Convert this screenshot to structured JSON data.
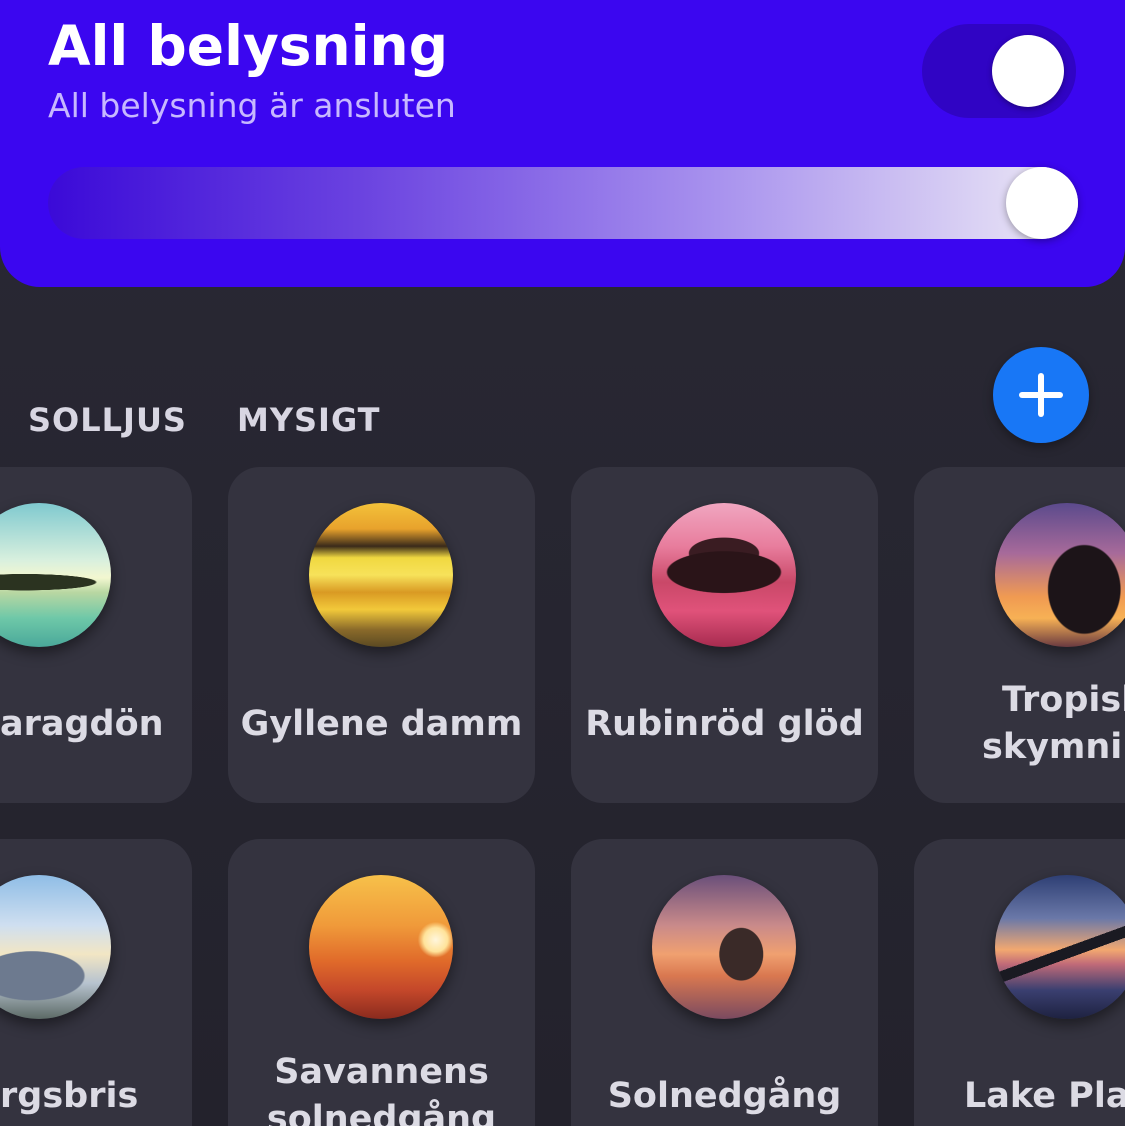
{
  "room": {
    "title": "All belysning",
    "subtitle": "All belysning är ansluten",
    "power_on": true,
    "brightness_percent": 100
  },
  "tabs": [
    {
      "label": "SOLLJUS"
    },
    {
      "label": "MYSIGT"
    }
  ],
  "add_button": {
    "icon": "plus-icon"
  },
  "scenes": [
    {
      "label": "aragdön",
      "image": "emerald-island-photo"
    },
    {
      "label": "Gyllene damm",
      "image": "golden-pond-photo"
    },
    {
      "label": "Rubinröd glöd",
      "image": "ruby-glow-photo"
    },
    {
      "label_line1": "Tropisk",
      "label_line2": "skymnin",
      "image": "tropical-dusk-photo"
    },
    {
      "label": "rgsbris",
      "image": "mountain-breeze-photo"
    },
    {
      "label_line1": "Savannens",
      "label_line2": "solnedgång",
      "image": "savanna-sunset-photo"
    },
    {
      "label": "Solnedgång",
      "image": "sunset-photo"
    },
    {
      "label": "Lake Plac",
      "image": "lake-placid-photo"
    }
  ],
  "colors": {
    "header": "#3b06f0",
    "background": "#24232e",
    "card": "#34333f",
    "add_button": "#1877f6"
  }
}
